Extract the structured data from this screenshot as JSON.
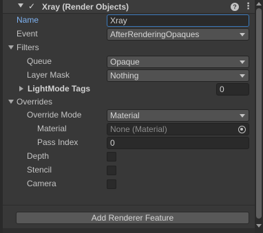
{
  "header": {
    "title": "Xray (Render Objects)",
    "enabled_check": "✓",
    "help_glyph": "?",
    "menu_glyph": "⋮"
  },
  "fields": {
    "name": {
      "label": "Name",
      "value": "Xray"
    },
    "event": {
      "label": "Event",
      "value": "AfterRenderingOpaques"
    },
    "filters": {
      "label": "Filters"
    },
    "queue": {
      "label": "Queue",
      "value": "Opaque"
    },
    "layer_mask": {
      "label": "Layer Mask",
      "value": "Nothing"
    },
    "lightmode_tags": {
      "label": "LightMode Tags",
      "value": "0"
    },
    "overrides": {
      "label": "Overrides"
    },
    "override_mode": {
      "label": "Override Mode",
      "value": "Material"
    },
    "material": {
      "label": "Material",
      "value": "None (Material)"
    },
    "pass_index": {
      "label": "Pass Index",
      "value": "0"
    },
    "depth": {
      "label": "Depth"
    },
    "stencil": {
      "label": "Stencil"
    },
    "camera": {
      "label": "Camera"
    }
  },
  "add_button": {
    "label": "Add Renderer Feature"
  },
  "colors": {
    "background": "#383838",
    "field_bg": "#2a2a2a",
    "dropdown_bg": "#515151",
    "selected_label": "#7fb3f2",
    "active_border": "#3a79bb"
  }
}
